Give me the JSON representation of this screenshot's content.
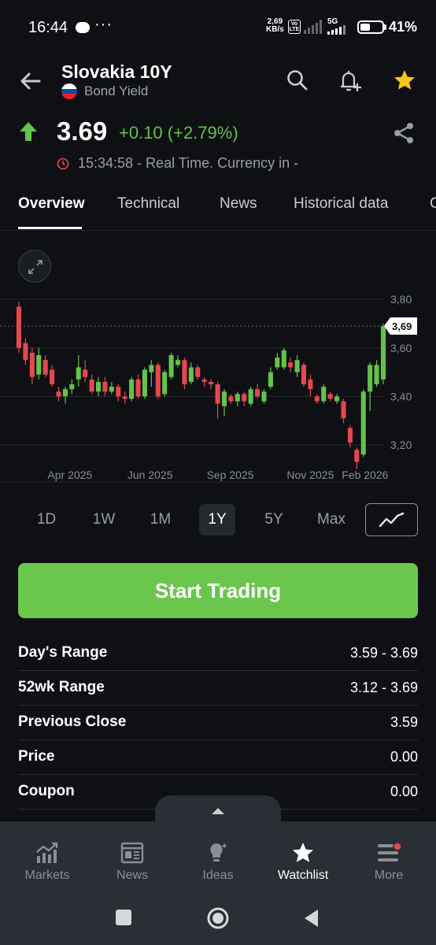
{
  "status_bar": {
    "time": "16:44",
    "speed_value": "2,69",
    "speed_unit": "KB/s",
    "volte_label": "Vo LTE",
    "network": "5G",
    "battery": "41%"
  },
  "header": {
    "title": "Slovakia 10Y",
    "subtitle": "Bond Yield",
    "flag_colors": [
      "#ffffff",
      "#0b4ea2",
      "#ee1c25"
    ],
    "icons": [
      "back-arrow-icon",
      "search-icon",
      "add-alert-icon",
      "star-icon"
    ],
    "star_color": "#f5c518"
  },
  "quote": {
    "price": "3.69",
    "change": "+0.10 (+2.79%)",
    "time_text": "15:34:58 - Real Time. Currency in -",
    "up_color": "#63c34a",
    "down_color": "#e5484d"
  },
  "tabs": [
    {
      "label": "Overview",
      "active": true
    },
    {
      "label": "Technical",
      "active": false
    },
    {
      "label": "News",
      "active": false
    },
    {
      "label": "Historical data",
      "active": false
    },
    {
      "label": "C",
      "active": false
    }
  ],
  "chart_data": {
    "type": "candlestick",
    "x_ticks": [
      "Apr 2025",
      "Jun 2025",
      "Sep 2025",
      "Nov 2025",
      "Feb 2026"
    ],
    "y_ticks": [
      "3,80",
      "3,60",
      "3,40",
      "3,20"
    ],
    "ylim": [
      3.08,
      3.82
    ],
    "last_value_label": "3,69",
    "last_value": 3.69,
    "grid": true,
    "candles": [
      {
        "o": 3.77,
        "c": 3.6,
        "h": 3.79,
        "l": 3.58
      },
      {
        "o": 3.62,
        "c": 3.55,
        "h": 3.64,
        "l": 3.53
      },
      {
        "o": 3.58,
        "c": 3.48,
        "h": 3.6,
        "l": 3.45
      },
      {
        "o": 3.49,
        "c": 3.57,
        "h": 3.6,
        "l": 3.47
      },
      {
        "o": 3.55,
        "c": 3.49,
        "h": 3.57,
        "l": 3.48
      },
      {
        "o": 3.51,
        "c": 3.45,
        "h": 3.53,
        "l": 3.44
      },
      {
        "o": 3.42,
        "c": 3.4,
        "h": 3.44,
        "l": 3.38
      },
      {
        "o": 3.4,
        "c": 3.43,
        "h": 3.44,
        "l": 3.37
      },
      {
        "o": 3.43,
        "c": 3.45,
        "h": 3.47,
        "l": 3.41
      },
      {
        "o": 3.47,
        "c": 3.52,
        "h": 3.57,
        "l": 3.44
      },
      {
        "o": 3.51,
        "c": 3.48,
        "h": 3.55,
        "l": 3.46
      },
      {
        "o": 3.47,
        "c": 3.42,
        "h": 3.49,
        "l": 3.41
      },
      {
        "o": 3.42,
        "c": 3.46,
        "h": 3.48,
        "l": 3.4
      },
      {
        "o": 3.46,
        "c": 3.42,
        "h": 3.48,
        "l": 3.4
      },
      {
        "o": 3.42,
        "c": 3.44,
        "h": 3.46,
        "l": 3.41
      },
      {
        "o": 3.44,
        "c": 3.4,
        "h": 3.45,
        "l": 3.38
      },
      {
        "o": 3.4,
        "c": 3.39,
        "h": 3.42,
        "l": 3.37
      },
      {
        "o": 3.39,
        "c": 3.47,
        "h": 3.48,
        "l": 3.38
      },
      {
        "o": 3.47,
        "c": 3.4,
        "h": 3.49,
        "l": 3.39
      },
      {
        "o": 3.4,
        "c": 3.51,
        "h": 3.52,
        "l": 3.39
      },
      {
        "o": 3.5,
        "c": 3.53,
        "h": 3.55,
        "l": 3.44
      },
      {
        "o": 3.53,
        "c": 3.4,
        "h": 3.54,
        "l": 3.39
      },
      {
        "o": 3.41,
        "c": 3.5,
        "h": 3.51,
        "l": 3.4
      },
      {
        "o": 3.48,
        "c": 3.57,
        "h": 3.58,
        "l": 3.47
      },
      {
        "o": 3.53,
        "c": 3.55,
        "h": 3.57,
        "l": 3.52
      },
      {
        "o": 3.55,
        "c": 3.45,
        "h": 3.56,
        "l": 3.43
      },
      {
        "o": 3.46,
        "c": 3.52,
        "h": 3.54,
        "l": 3.45
      },
      {
        "o": 3.52,
        "c": 3.48,
        "h": 3.53,
        "l": 3.47
      },
      {
        "o": 3.47,
        "c": 3.46,
        "h": 3.48,
        "l": 3.44
      },
      {
        "o": 3.46,
        "c": 3.45,
        "h": 3.47,
        "l": 3.43
      },
      {
        "o": 3.45,
        "c": 3.37,
        "h": 3.46,
        "l": 3.31
      },
      {
        "o": 3.36,
        "c": 3.42,
        "h": 3.43,
        "l": 3.32
      },
      {
        "o": 3.4,
        "c": 3.38,
        "h": 3.41,
        "l": 3.37
      },
      {
        "o": 3.38,
        "c": 3.41,
        "h": 3.42,
        "l": 3.36
      },
      {
        "o": 3.41,
        "c": 3.38,
        "h": 3.42,
        "l": 3.36
      },
      {
        "o": 3.37,
        "c": 3.43,
        "h": 3.44,
        "l": 3.36
      },
      {
        "o": 3.43,
        "c": 3.4,
        "h": 3.45,
        "l": 3.39
      },
      {
        "o": 3.38,
        "c": 3.42,
        "h": 3.43,
        "l": 3.37
      },
      {
        "o": 3.44,
        "c": 3.5,
        "h": 3.52,
        "l": 3.43
      },
      {
        "o": 3.52,
        "c": 3.56,
        "h": 3.58,
        "l": 3.51
      },
      {
        "o": 3.52,
        "c": 3.59,
        "h": 3.6,
        "l": 3.51
      },
      {
        "o": 3.54,
        "c": 3.52,
        "h": 3.56,
        "l": 3.5
      },
      {
        "o": 3.5,
        "c": 3.55,
        "h": 3.57,
        "l": 3.48
      },
      {
        "o": 3.53,
        "c": 3.45,
        "h": 3.54,
        "l": 3.44
      },
      {
        "o": 3.47,
        "c": 3.43,
        "h": 3.49,
        "l": 3.4
      },
      {
        "o": 3.4,
        "c": 3.38,
        "h": 3.41,
        "l": 3.37
      },
      {
        "o": 3.38,
        "c": 3.44,
        "h": 3.45,
        "l": 3.37
      },
      {
        "o": 3.41,
        "c": 3.39,
        "h": 3.42,
        "l": 3.38
      },
      {
        "o": 3.38,
        "c": 3.4,
        "h": 3.41,
        "l": 3.37
      },
      {
        "o": 3.38,
        "c": 3.31,
        "h": 3.39,
        "l": 3.29
      },
      {
        "o": 3.27,
        "c": 3.21,
        "h": 3.28,
        "l": 3.19
      },
      {
        "o": 3.18,
        "c": 3.13,
        "h": 3.19,
        "l": 3.1
      },
      {
        "o": 3.16,
        "c": 3.42,
        "h": 3.43,
        "l": 3.15
      },
      {
        "o": 3.42,
        "c": 3.53,
        "h": 3.54,
        "l": 3.34
      },
      {
        "o": 3.45,
        "c": 3.53,
        "h": 3.55,
        "l": 3.44
      },
      {
        "o": 3.47,
        "c": 3.69,
        "h": 3.7,
        "l": 3.45
      }
    ]
  },
  "ranges": [
    {
      "label": "1D",
      "active": false
    },
    {
      "label": "1W",
      "active": false
    },
    {
      "label": "1M",
      "active": false
    },
    {
      "label": "1Y",
      "active": true
    },
    {
      "label": "5Y",
      "active": false
    },
    {
      "label": "Max",
      "active": false
    }
  ],
  "trade_button": "Start Trading",
  "stats": [
    {
      "label": "Day's Range",
      "value": "3.59 - 3.69"
    },
    {
      "label": "52wk Range",
      "value": "3.12 - 3.69"
    },
    {
      "label": "Previous Close",
      "value": "3.59"
    },
    {
      "label": "Price",
      "value": "0.00"
    },
    {
      "label": "Coupon",
      "value": "0.00"
    }
  ],
  "bottom_nav": [
    {
      "label": "Markets",
      "icon": "markets-icon",
      "active": false
    },
    {
      "label": "News",
      "icon": "news-icon",
      "active": false
    },
    {
      "label": "Ideas",
      "icon": "ideas-icon",
      "active": false
    },
    {
      "label": "Watchlist",
      "icon": "star-icon",
      "active": true
    },
    {
      "label": "More",
      "icon": "menu-icon",
      "active": false
    }
  ],
  "notification_color": "#e5484d"
}
